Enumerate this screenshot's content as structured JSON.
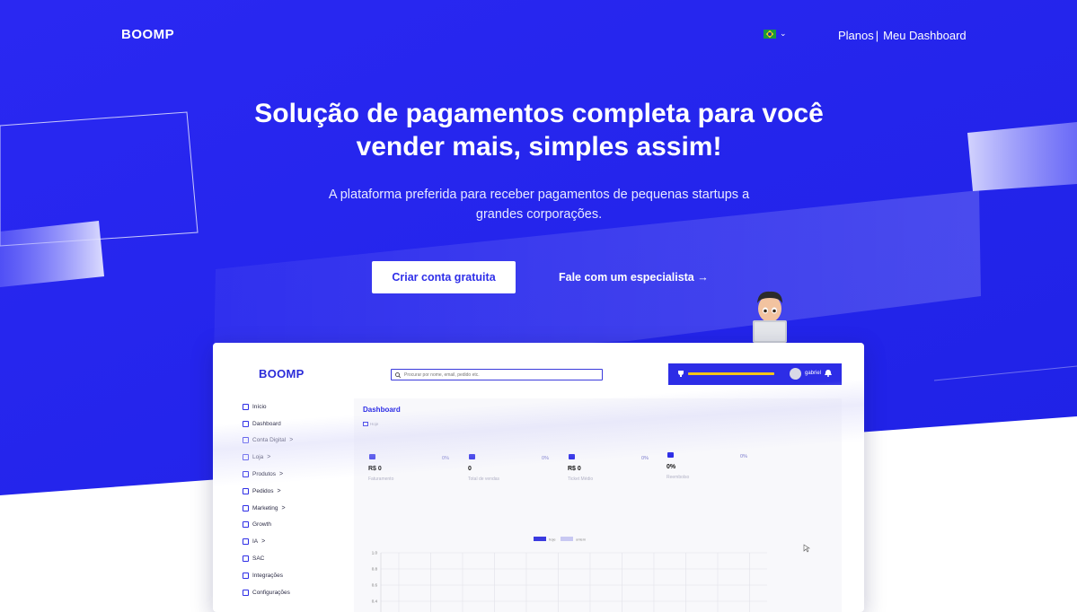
{
  "nav": {
    "logo": "BOOMP",
    "language_flag": "brazil-flag",
    "links": [
      "Planos",
      "Meu Dashboard"
    ],
    "separator": "|"
  },
  "hero": {
    "title": "Solução de pagamentos completa para você vender mais, simples assim!",
    "subtitle": "A plataforma preferida para receber pagamentos de pequenas startups a grandes corporações.",
    "primary_button": "Criar conta gratuita",
    "secondary_link": "Fale com um especialista",
    "secondary_link_arrow": "→"
  },
  "dashboard": {
    "logo": "BOOMP",
    "search_placeholder": "Procurar por nome, email, pedido etc.",
    "user_name": "gabriel",
    "progress": 1.0,
    "page_title": "Dashboard",
    "date_label": "Hoje",
    "sidebar": [
      {
        "label": "Início",
        "icon": "home-icon",
        "caret": ""
      },
      {
        "label": "Dashboard",
        "icon": "grid-icon",
        "caret": ""
      },
      {
        "label": "Conta Digital",
        "icon": "people-icon",
        "caret": ">"
      },
      {
        "label": "Loja",
        "icon": "store-icon",
        "caret": ">"
      },
      {
        "label": "Produtos",
        "icon": "box-icon",
        "caret": ">"
      },
      {
        "label": "Pedidos",
        "icon": "clipboard-icon",
        "caret": ">"
      },
      {
        "label": "Marketing",
        "icon": "megaphone-icon",
        "caret": ">"
      },
      {
        "label": "Growth",
        "icon": "trend-icon",
        "caret": ""
      },
      {
        "label": "IA",
        "icon": "user-icon",
        "caret": ">"
      },
      {
        "label": "SAC",
        "icon": "headset-icon",
        "caret": ""
      },
      {
        "label": "Integrações",
        "icon": "integrations-icon",
        "caret": ""
      },
      {
        "label": "Configurações",
        "icon": "sliders-icon",
        "caret": ""
      }
    ],
    "kpis": [
      {
        "value": "R$ 0",
        "label": "Faturamento",
        "pct": "0%",
        "icon": "basket-icon"
      },
      {
        "value": "0",
        "label": "Total de vendas",
        "pct": "0%",
        "icon": "cart-icon"
      },
      {
        "value": "R$ 0",
        "label": "Ticket Médio",
        "pct": "0%",
        "icon": "card-icon"
      },
      {
        "value": "0%",
        "label": "Reembolso",
        "pct": "0%",
        "icon": "percent-icon"
      }
    ]
  },
  "chart_data": {
    "type": "bar",
    "series": [
      {
        "name": "hoje",
        "values": []
      },
      {
        "name": "ontem",
        "values": []
      }
    ],
    "yticks": [
      "1.0",
      "0.8",
      "0.6",
      "0.4"
    ],
    "ylim": [
      0,
      1.0
    ],
    "grid": true,
    "legend": "top-center",
    "colors": [
      "#3b3be0",
      "#c8c8f2"
    ]
  },
  "colors": {
    "brand_blue": "#2f2fe8",
    "hero_bg": "#2a2af0",
    "accent_yellow": "#f5c518"
  }
}
